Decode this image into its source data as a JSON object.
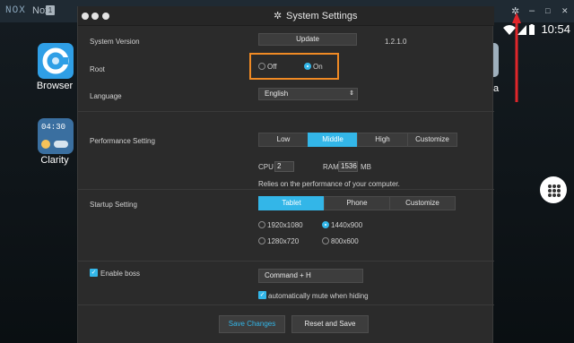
{
  "topbar": {
    "logo": "NOX",
    "app_name": "Nox",
    "badge": "1",
    "minimize": "–",
    "maximize": "□",
    "close": "✕"
  },
  "android": {
    "clock": "10:54",
    "apps": [
      {
        "label": "Browser"
      },
      {
        "label": "Clarity"
      }
    ],
    "partial_label": "a",
    "clarity_time": "04:30"
  },
  "dialog": {
    "title": "System Settings",
    "system_version": {
      "label": "System Version",
      "button": "Update",
      "version": "1.2.1.0"
    },
    "root": {
      "label": "Root",
      "options": [
        "Off",
        "On"
      ],
      "selected": "On"
    },
    "language": {
      "label": "Language",
      "value": "English"
    },
    "performance": {
      "label": "Performance Setting",
      "options": [
        "Low",
        "Middle",
        "High",
        "Customize"
      ],
      "selected": "Middle",
      "cpu_label": "CPU",
      "cpu_value": "2",
      "ram_label": "RAM",
      "ram_value": "1536",
      "ram_unit": "MB",
      "note": "Relies on the performance of your computer."
    },
    "startup": {
      "label": "Startup Setting",
      "options": [
        "Tablet",
        "Phone",
        "Customize"
      ],
      "selected": "Tablet",
      "resolutions": [
        "1920x1080",
        "1440x900",
        "1280x720",
        "800x600"
      ],
      "selected_resolution": "1440x900"
    },
    "boss": {
      "label": "Enable boss",
      "checked": true,
      "shortcut": "Command + H",
      "mute_label": "automatically mute when hiding",
      "mute_checked": true
    },
    "footer": {
      "save": "Save Changes",
      "reset": "Reset and Save"
    }
  },
  "colors": {
    "accent": "#33b6e8",
    "highlight_box": "#f08a24",
    "arrow": "#e0262b",
    "dialog_bg": "#2b2b2b"
  }
}
